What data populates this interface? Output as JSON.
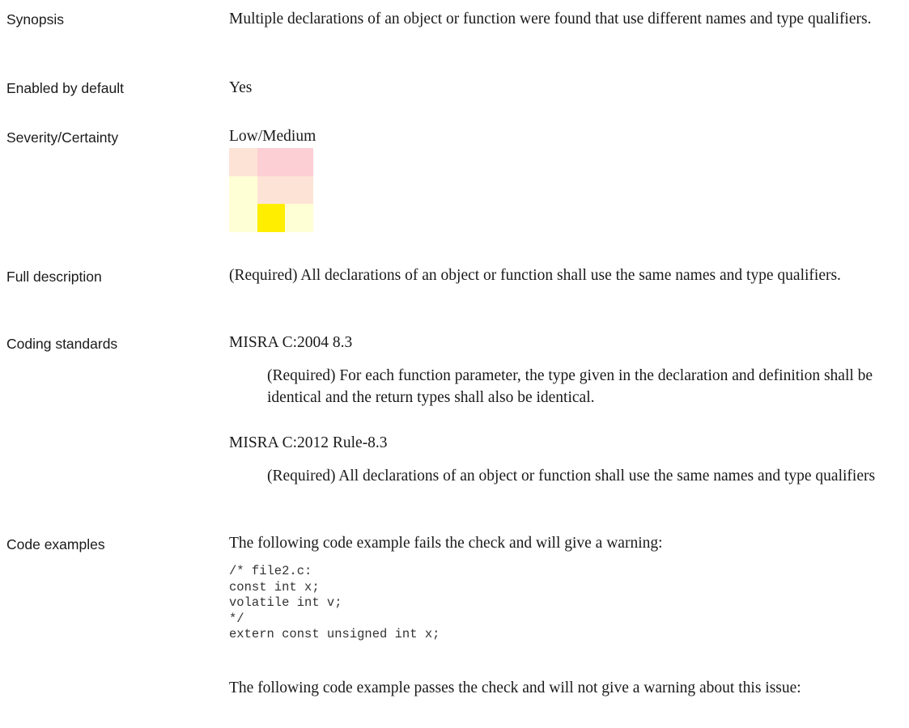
{
  "rows": {
    "synopsis": {
      "label": "Synopsis",
      "text": "Multiple declarations of an object or function were found that use different names and type qualifiers."
    },
    "enabled": {
      "label": "Enabled by default",
      "value": "Yes"
    },
    "severity": {
      "label": "Severity/Certainty",
      "value": "Low/Medium",
      "matrix_colors": [
        [
          "#fde3d6",
          "#fccfd4",
          "#fccfd4"
        ],
        [
          "#ffffd6",
          "#fde3d6",
          "#fde3d6"
        ],
        [
          "#ffffd6",
          "#ffee00",
          "#ffffd6"
        ]
      ]
    },
    "full_description": {
      "label": "Full description",
      "text": "(Required) All declarations of an object or function shall use the same names and type qualifiers."
    },
    "coding_standards": {
      "label": "Coding standards",
      "standards": [
        {
          "name": "MISRA C:2004 8.3",
          "description": "(Required) For each function parameter, the type given in the declaration and definition shall be identical and the return types shall also be identical."
        },
        {
          "name": "MISRA C:2012 Rule-8.3",
          "description": "(Required) All declarations of an object or function shall use the same names and type qualifiers"
        }
      ]
    },
    "code_examples": {
      "label": "Code examples",
      "fail_intro": "The following code example fails the check and will give a warning:",
      "fail_code": "/* file2.c:\nconst int x;\nvolatile int v;\n*/\nextern const unsigned int x;",
      "pass_intro": "The following code example passes the check and will not give a warning about this issue:"
    }
  }
}
